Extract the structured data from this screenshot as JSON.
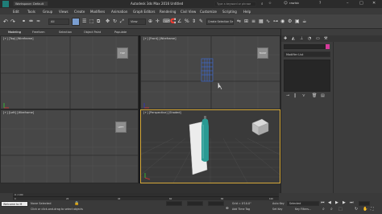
{
  "title_bar": {
    "workspace": "Workspace: Default",
    "app_title": "Autodesk 3ds Max 2016    Untitled",
    "search_placeholder": "Type a keyword or phrase",
    "user": "rawlsb"
  },
  "menu": [
    "Edit",
    "Tools",
    "Group",
    "Views",
    "Create",
    "Modifiers",
    "Animation",
    "Graph Editors",
    "Rendering",
    "Civil View",
    "Customize",
    "Scripting",
    "Help"
  ],
  "toolbar": {
    "selection_filter": "All",
    "view_dropdown": "View",
    "create_selection_set": "Create Selection Se"
  },
  "ribbon_tabs": [
    "Modeling",
    "Freeform",
    "Selection",
    "Object Paint",
    "Populate"
  ],
  "viewports": {
    "top": "[+] [Top] [Wireframe]",
    "front": "[+] [Front] [Wireframe]",
    "left": "[+] [Left] [Wireframe]",
    "perspective": "[+] [Perspective] [Shaded]"
  },
  "viewcube": {
    "top": "TOP",
    "front": "FRONT",
    "left": "LEFT"
  },
  "command_panel": {
    "modifier_list": "Modifier List"
  },
  "timeline": {
    "frame_counter": "0 / 100",
    "ticks": [
      "0",
      "5",
      "10",
      "15",
      "20",
      "25",
      "30",
      "35",
      "40",
      "45",
      "50",
      "55",
      "60",
      "65",
      "70",
      "75",
      "80",
      "85",
      "90",
      "95",
      "100"
    ]
  },
  "status": {
    "listener": "Welcome to M",
    "selection": "None Selected",
    "prompt": "Click or click-and-drag to select objects",
    "grid": "Grid = 0'10.0\"",
    "add_time_tag": "Add Time Tag",
    "auto_key": "Auto Key",
    "set_key": "Set Key",
    "selected": "Selected",
    "key_filters": "Key Filters..."
  },
  "colors": {
    "bottle": "#2a9a93",
    "accent": "#d53a9a",
    "active_border": "#d6a93a"
  }
}
